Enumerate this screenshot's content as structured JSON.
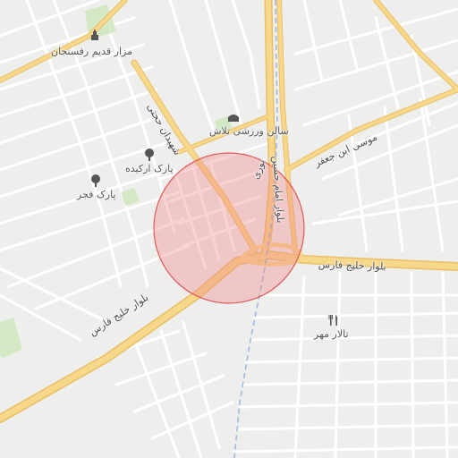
{
  "map": {
    "colors": {
      "background": "#eeeeec",
      "block": "#f7f7f5",
      "street": "#ffffff",
      "major_road": "#f7d78a",
      "major_road_casing": "#e9bf67",
      "railway": "#9ab6d8",
      "park": "#d3e9c5",
      "highlight_fill": "#f28a8a",
      "highlight_stroke": "#e05a5a"
    },
    "pois": [
      {
        "name": "مزار قدیم رفسنجان",
        "icon": "cemetery-icon"
      },
      {
        "name": "سالن ورزشی تلاش",
        "icon": "sports-hall-icon"
      },
      {
        "name": "پارک ارکیده",
        "icon": "park-tree-icon"
      },
      {
        "name": "پارک فجر",
        "icon": "park-tree-icon"
      },
      {
        "name": "تالار مهر",
        "icon": "restaurant-icon"
      }
    ],
    "roads": {
      "khalij_fars_west": "بلوار خلیج فارس",
      "khalij_fars_east": "بلوار خلیج فارس",
      "imam_hossein": "بلوار امام حسین",
      "musa_ibn_jafar": "موسی ابن جعفر",
      "shahidan": "شهیدان حجتی",
      "nouri": "نوری"
    }
  }
}
